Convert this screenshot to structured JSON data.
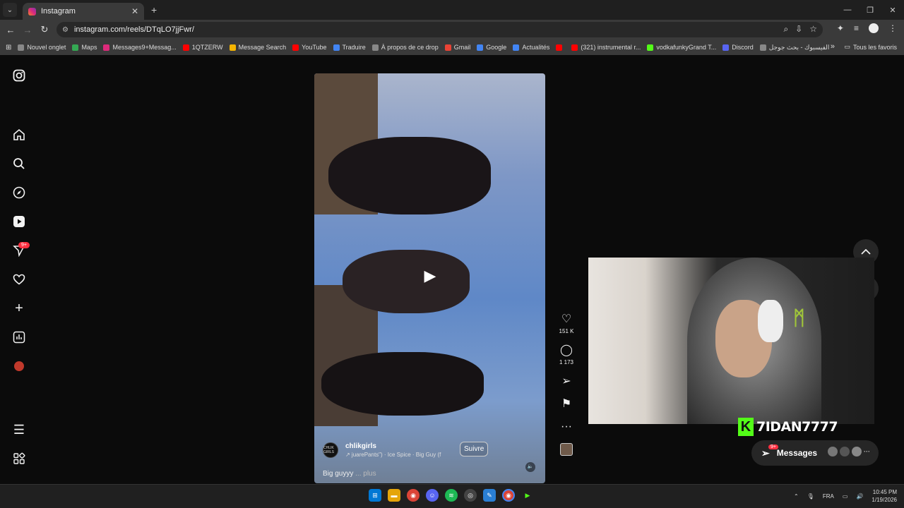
{
  "browser": {
    "tab_title": "Instagram",
    "url": "instagram.com/reels/DTqLO7jjFwr/",
    "bookmarks": [
      {
        "label": "Nouvel onglet",
        "color": "#888888"
      },
      {
        "label": "Maps",
        "color": "#34a853"
      },
      {
        "label": "Messages9+Messag...",
        "color": "#dd2a7b"
      },
      {
        "label": "1QTZERW",
        "color": "#ff0000"
      },
      {
        "label": "Message Search",
        "color": "#f4b400"
      },
      {
        "label": "YouTube",
        "color": "#ff0000"
      },
      {
        "label": "Traduire",
        "color": "#4285f4"
      },
      {
        "label": "À propos de ce drop",
        "color": "#888888"
      },
      {
        "label": "Gmail",
        "color": "#ea4335"
      },
      {
        "label": "Google",
        "color": "#4285f4"
      },
      {
        "label": "Actualités",
        "color": "#4285f4"
      },
      {
        "label": "",
        "color": "#ff0000"
      },
      {
        "label": "(321) instrumental r...",
        "color": "#ff0000"
      },
      {
        "label": "vodkafunkyGrand T...",
        "color": "#53fc18"
      },
      {
        "label": "Discord",
        "color": "#5865f2"
      },
      {
        "label": "الفيسبوك - بحث جوجل",
        "color": "#888888"
      }
    ],
    "all_bookmarks": "Tous les favoris"
  },
  "sidebar": {
    "badge": "9+"
  },
  "reel": {
    "username": "chlikgirls",
    "audio": "↗ juarePants\") · Ice Spice · Big Guy (f",
    "follow_label": "Suivre",
    "caption": "Big guyyy",
    "caption_more": "... plus",
    "pfp_text": "CHLIK GIRLS",
    "likes": "151 K",
    "comments": "1 173"
  },
  "overlay": {
    "streamer_name": "7IDAN7777",
    "messages_label": "Messages",
    "messages_badge": "9+"
  },
  "taskbar": {
    "lang": "FRA",
    "time": "10:45 PM",
    "date": "1/19/2026"
  }
}
